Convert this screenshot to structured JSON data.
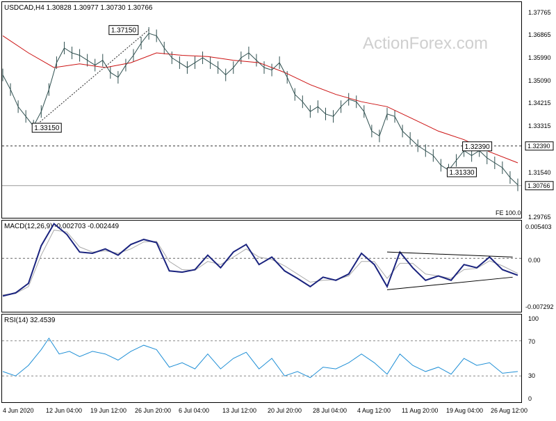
{
  "chart_data": [
    {
      "type": "candlestick",
      "title": "USDCAD,H4  1.30828 1.30977 1.30730 1.30766",
      "watermark": "ActionForex.com",
      "ylim": [
        1.2945,
        1.3828
      ],
      "y_ticks": [
        "1.37765",
        "1.36865",
        "1.35990",
        "1.35090",
        "1.34215",
        "1.33315",
        "1.32390",
        "1.31540",
        "1.30766",
        "1.29765"
      ],
      "x_ticks": [
        "4 Jun 2020",
        "12 Jun 04:00",
        "19 Jun 12:00",
        "26 Jun 20:00",
        "6 Jul 04:00",
        "13 Jul 12:00",
        "20 Jul 20:00",
        "28 Jul 04:00",
        "4 Aug 12:00",
        "11 Aug 20:00",
        "19 Aug 04:00",
        "26 Aug 12:00"
      ],
      "price_series": [
        {
          "x": 0,
          "y": 1.353
        },
        {
          "x": 3,
          "y": 1.347
        },
        {
          "x": 6,
          "y": 1.34
        },
        {
          "x": 9,
          "y": 1.336
        },
        {
          "x": 12,
          "y": 1.332
        },
        {
          "x": 15,
          "y": 1.338
        },
        {
          "x": 18,
          "y": 1.347
        },
        {
          "x": 21,
          "y": 1.358
        },
        {
          "x": 24,
          "y": 1.364
        },
        {
          "x": 27,
          "y": 1.362
        },
        {
          "x": 30,
          "y": 1.361
        },
        {
          "x": 33,
          "y": 1.359
        },
        {
          "x": 36,
          "y": 1.357
        },
        {
          "x": 39,
          "y": 1.359
        },
        {
          "x": 42,
          "y": 1.354
        },
        {
          "x": 45,
          "y": 1.352
        },
        {
          "x": 48,
          "y": 1.357
        },
        {
          "x": 51,
          "y": 1.361
        },
        {
          "x": 54,
          "y": 1.366
        },
        {
          "x": 57,
          "y": 1.37
        },
        {
          "x": 60,
          "y": 1.369
        },
        {
          "x": 63,
          "y": 1.364
        },
        {
          "x": 66,
          "y": 1.36
        },
        {
          "x": 69,
          "y": 1.358
        },
        {
          "x": 72,
          "y": 1.356
        },
        {
          "x": 75,
          "y": 1.358
        },
        {
          "x": 78,
          "y": 1.36
        },
        {
          "x": 81,
          "y": 1.358
        },
        {
          "x": 84,
          "y": 1.356
        },
        {
          "x": 87,
          "y": 1.353
        },
        {
          "x": 90,
          "y": 1.356
        },
        {
          "x": 93,
          "y": 1.36
        },
        {
          "x": 96,
          "y": 1.362
        },
        {
          "x": 99,
          "y": 1.359
        },
        {
          "x": 102,
          "y": 1.356
        },
        {
          "x": 105,
          "y": 1.355
        },
        {
          "x": 108,
          "y": 1.358
        },
        {
          "x": 111,
          "y": 1.352
        },
        {
          "x": 114,
          "y": 1.345
        },
        {
          "x": 117,
          "y": 1.342
        },
        {
          "x": 120,
          "y": 1.338
        },
        {
          "x": 123,
          "y": 1.34
        },
        {
          "x": 126,
          "y": 1.337
        },
        {
          "x": 129,
          "y": 1.336
        },
        {
          "x": 132,
          "y": 1.34
        },
        {
          "x": 135,
          "y": 1.343
        },
        {
          "x": 138,
          "y": 1.342
        },
        {
          "x": 141,
          "y": 1.338
        },
        {
          "x": 144,
          "y": 1.33
        },
        {
          "x": 147,
          "y": 1.328
        },
        {
          "x": 150,
          "y": 1.337
        },
        {
          "x": 153,
          "y": 1.336
        },
        {
          "x": 156,
          "y": 1.33
        },
        {
          "x": 159,
          "y": 1.327
        },
        {
          "x": 162,
          "y": 1.324
        },
        {
          "x": 165,
          "y": 1.322
        },
        {
          "x": 168,
          "y": 1.32
        },
        {
          "x": 171,
          "y": 1.316
        },
        {
          "x": 174,
          "y": 1.314
        },
        {
          "x": 177,
          "y": 1.318
        },
        {
          "x": 180,
          "y": 1.322
        },
        {
          "x": 183,
          "y": 1.32
        },
        {
          "x": 186,
          "y": 1.322
        },
        {
          "x": 189,
          "y": 1.319
        },
        {
          "x": 192,
          "y": 1.317
        },
        {
          "x": 195,
          "y": 1.315
        },
        {
          "x": 198,
          "y": 1.311
        },
        {
          "x": 201,
          "y": 1.308
        }
      ],
      "ma_series": [
        {
          "x": 0,
          "y": 1.369
        },
        {
          "x": 10,
          "y": 1.362
        },
        {
          "x": 20,
          "y": 1.356
        },
        {
          "x": 30,
          "y": 1.3575
        },
        {
          "x": 40,
          "y": 1.356
        },
        {
          "x": 50,
          "y": 1.358
        },
        {
          "x": 60,
          "y": 1.362
        },
        {
          "x": 70,
          "y": 1.361
        },
        {
          "x": 80,
          "y": 1.3605
        },
        {
          "x": 90,
          "y": 1.359
        },
        {
          "x": 100,
          "y": 1.358
        },
        {
          "x": 110,
          "y": 1.354
        },
        {
          "x": 120,
          "y": 1.349
        },
        {
          "x": 130,
          "y": 1.345
        },
        {
          "x": 140,
          "y": 1.342
        },
        {
          "x": 150,
          "y": 1.34
        },
        {
          "x": 160,
          "y": 1.335
        },
        {
          "x": 170,
          "y": 1.33
        },
        {
          "x": 180,
          "y": 1.3265
        },
        {
          "x": 190,
          "y": 1.3215
        },
        {
          "x": 201,
          "y": 1.317
        }
      ],
      "horizontal_lines": [
        {
          "value": 1.3239,
          "style": "dashed",
          "label": "1.32390"
        },
        {
          "value": 1.30766,
          "style": "solid",
          "label": "1.30766"
        }
      ],
      "trendlines": [
        {
          "x1": 12,
          "y1": 1.3315,
          "x2": 57,
          "y2": 1.3715
        }
      ],
      "annotations": [
        {
          "x": 42,
          "y": 1.3715,
          "text": "1.37150"
        },
        {
          "x": 12,
          "y": 1.3315,
          "text": "1.33150"
        },
        {
          "x": 180,
          "y": 1.3239,
          "text": "1.32390"
        },
        {
          "x": 174,
          "y": 1.3133,
          "text": "1.31330"
        }
      ],
      "footnote": "FE 100.0",
      "colors": {
        "price": "#2f4f4f",
        "ma": "#cc1111"
      }
    },
    {
      "type": "line",
      "title": "MACD(12,26,9) -0.002703 -0.002449",
      "ylim": [
        -0.0085,
        0.006
      ],
      "y_ticks": [
        "0.005403",
        "0.00",
        "-0.007292"
      ],
      "series": [
        {
          "name": "",
          "color": "#1a237e",
          "points": [
            {
              "x": 0,
              "y": -0.006
            },
            {
              "x": 5,
              "y": -0.0055
            },
            {
              "x": 10,
              "y": -0.004
            },
            {
              "x": 15,
              "y": 0.002
            },
            {
              "x": 20,
              "y": 0.0055
            },
            {
              "x": 25,
              "y": 0.0038
            },
            {
              "x": 30,
              "y": 0.001
            },
            {
              "x": 35,
              "y": 0.0008
            },
            {
              "x": 40,
              "y": 0.0015
            },
            {
              "x": 45,
              "y": 0.0005
            },
            {
              "x": 50,
              "y": 0.0022
            },
            {
              "x": 55,
              "y": 0.003
            },
            {
              "x": 60,
              "y": 0.0025
            },
            {
              "x": 65,
              "y": -0.002
            },
            {
              "x": 70,
              "y": -0.0022
            },
            {
              "x": 75,
              "y": -0.0018
            },
            {
              "x": 80,
              "y": 0.0005
            },
            {
              "x": 85,
              "y": -0.0015
            },
            {
              "x": 90,
              "y": 0.001
            },
            {
              "x": 95,
              "y": 0.0022
            },
            {
              "x": 100,
              "y": -0.001
            },
            {
              "x": 105,
              "y": 0.0002
            },
            {
              "x": 110,
              "y": -0.002
            },
            {
              "x": 115,
              "y": -0.0032
            },
            {
              "x": 120,
              "y": -0.0045
            },
            {
              "x": 125,
              "y": -0.003
            },
            {
              "x": 130,
              "y": -0.0035
            },
            {
              "x": 135,
              "y": -0.0025
            },
            {
              "x": 140,
              "y": 0.0008
            },
            {
              "x": 145,
              "y": -0.001
            },
            {
              "x": 150,
              "y": -0.0045
            },
            {
              "x": 155,
              "y": 0.001
            },
            {
              "x": 160,
              "y": -0.0015
            },
            {
              "x": 165,
              "y": -0.0035
            },
            {
              "x": 170,
              "y": -0.0028
            },
            {
              "x": 175,
              "y": -0.0035
            },
            {
              "x": 180,
              "y": -0.001
            },
            {
              "x": 185,
              "y": -0.0015
            },
            {
              "x": 190,
              "y": 0.0002
            },
            {
              "x": 195,
              "y": -0.0018
            },
            {
              "x": 201,
              "y": -0.0027
            }
          ]
        },
        {
          "name": "",
          "color": "#aaaaaa",
          "points": [
            {
              "x": 0,
              "y": -0.0058
            },
            {
              "x": 5,
              "y": -0.0056
            },
            {
              "x": 10,
              "y": -0.0045
            },
            {
              "x": 15,
              "y": 0.0005
            },
            {
              "x": 20,
              "y": 0.0045
            },
            {
              "x": 25,
              "y": 0.0042
            },
            {
              "x": 30,
              "y": 0.0018
            },
            {
              "x": 35,
              "y": 0.001
            },
            {
              "x": 40,
              "y": 0.0012
            },
            {
              "x": 45,
              "y": 0.0008
            },
            {
              "x": 50,
              "y": 0.0015
            },
            {
              "x": 55,
              "y": 0.0026
            },
            {
              "x": 60,
              "y": 0.0027
            },
            {
              "x": 65,
              "y": -0.0005
            },
            {
              "x": 70,
              "y": -0.0018
            },
            {
              "x": 75,
              "y": -0.0019
            },
            {
              "x": 80,
              "y": -0.0005
            },
            {
              "x": 85,
              "y": -0.001
            },
            {
              "x": 90,
              "y": 0.0002
            },
            {
              "x": 95,
              "y": 0.0015
            },
            {
              "x": 100,
              "y": 0.0002
            },
            {
              "x": 105,
              "y": -0.0002
            },
            {
              "x": 110,
              "y": -0.0012
            },
            {
              "x": 115,
              "y": -0.0025
            },
            {
              "x": 120,
              "y": -0.0038
            },
            {
              "x": 125,
              "y": -0.0035
            },
            {
              "x": 130,
              "y": -0.0034
            },
            {
              "x": 135,
              "y": -0.0028
            },
            {
              "x": 140,
              "y": -0.0005
            },
            {
              "x": 145,
              "y": -0.0005
            },
            {
              "x": 150,
              "y": -0.0032
            },
            {
              "x": 155,
              "y": -0.0008
            },
            {
              "x": 160,
              "y": -0.0008
            },
            {
              "x": 165,
              "y": -0.0025
            },
            {
              "x": 170,
              "y": -0.0028
            },
            {
              "x": 175,
              "y": -0.0032
            },
            {
              "x": 180,
              "y": -0.0018
            },
            {
              "x": 185,
              "y": -0.0016
            },
            {
              "x": 190,
              "y": -0.0004
            },
            {
              "x": 195,
              "y": -0.0012
            },
            {
              "x": 201,
              "y": -0.0024
            }
          ]
        }
      ],
      "trendlines": [
        {
          "x1": 150,
          "y1": 0.001,
          "x2": 199,
          "y2": 0.0002
        },
        {
          "x1": 150,
          "y1": -0.005,
          "x2": 199,
          "y2": -0.003
        }
      ],
      "zero_line": 0
    },
    {
      "type": "line",
      "title": "RSI(14) 32.4539",
      "ylim": [
        0,
        100
      ],
      "y_ticks": [
        "100",
        "70",
        "30",
        "0"
      ],
      "levels": [
        70,
        30
      ],
      "series": [
        {
          "name": "",
          "color": "#1f8fd6",
          "points": [
            {
              "x": 0,
              "y": 35
            },
            {
              "x": 5,
              "y": 30
            },
            {
              "x": 10,
              "y": 42
            },
            {
              "x": 15,
              "y": 60
            },
            {
              "x": 18,
              "y": 73
            },
            {
              "x": 22,
              "y": 55
            },
            {
              "x": 26,
              "y": 58
            },
            {
              "x": 30,
              "y": 52
            },
            {
              "x": 35,
              "y": 58
            },
            {
              "x": 40,
              "y": 55
            },
            {
              "x": 45,
              "y": 48
            },
            {
              "x": 50,
              "y": 58
            },
            {
              "x": 55,
              "y": 65
            },
            {
              "x": 60,
              "y": 60
            },
            {
              "x": 65,
              "y": 40
            },
            {
              "x": 70,
              "y": 45
            },
            {
              "x": 75,
              "y": 38
            },
            {
              "x": 80,
              "y": 55
            },
            {
              "x": 85,
              "y": 38
            },
            {
              "x": 90,
              "y": 50
            },
            {
              "x": 95,
              "y": 57
            },
            {
              "x": 100,
              "y": 38
            },
            {
              "x": 105,
              "y": 50
            },
            {
              "x": 110,
              "y": 30
            },
            {
              "x": 115,
              "y": 35
            },
            {
              "x": 120,
              "y": 28
            },
            {
              "x": 125,
              "y": 40
            },
            {
              "x": 130,
              "y": 38
            },
            {
              "x": 135,
              "y": 45
            },
            {
              "x": 140,
              "y": 55
            },
            {
              "x": 145,
              "y": 45
            },
            {
              "x": 150,
              "y": 32
            },
            {
              "x": 155,
              "y": 55
            },
            {
              "x": 160,
              "y": 42
            },
            {
              "x": 165,
              "y": 35
            },
            {
              "x": 170,
              "y": 40
            },
            {
              "x": 175,
              "y": 32
            },
            {
              "x": 180,
              "y": 50
            },
            {
              "x": 185,
              "y": 42
            },
            {
              "x": 190,
              "y": 45
            },
            {
              "x": 195,
              "y": 33
            },
            {
              "x": 201,
              "y": 35
            }
          ]
        }
      ]
    }
  ]
}
